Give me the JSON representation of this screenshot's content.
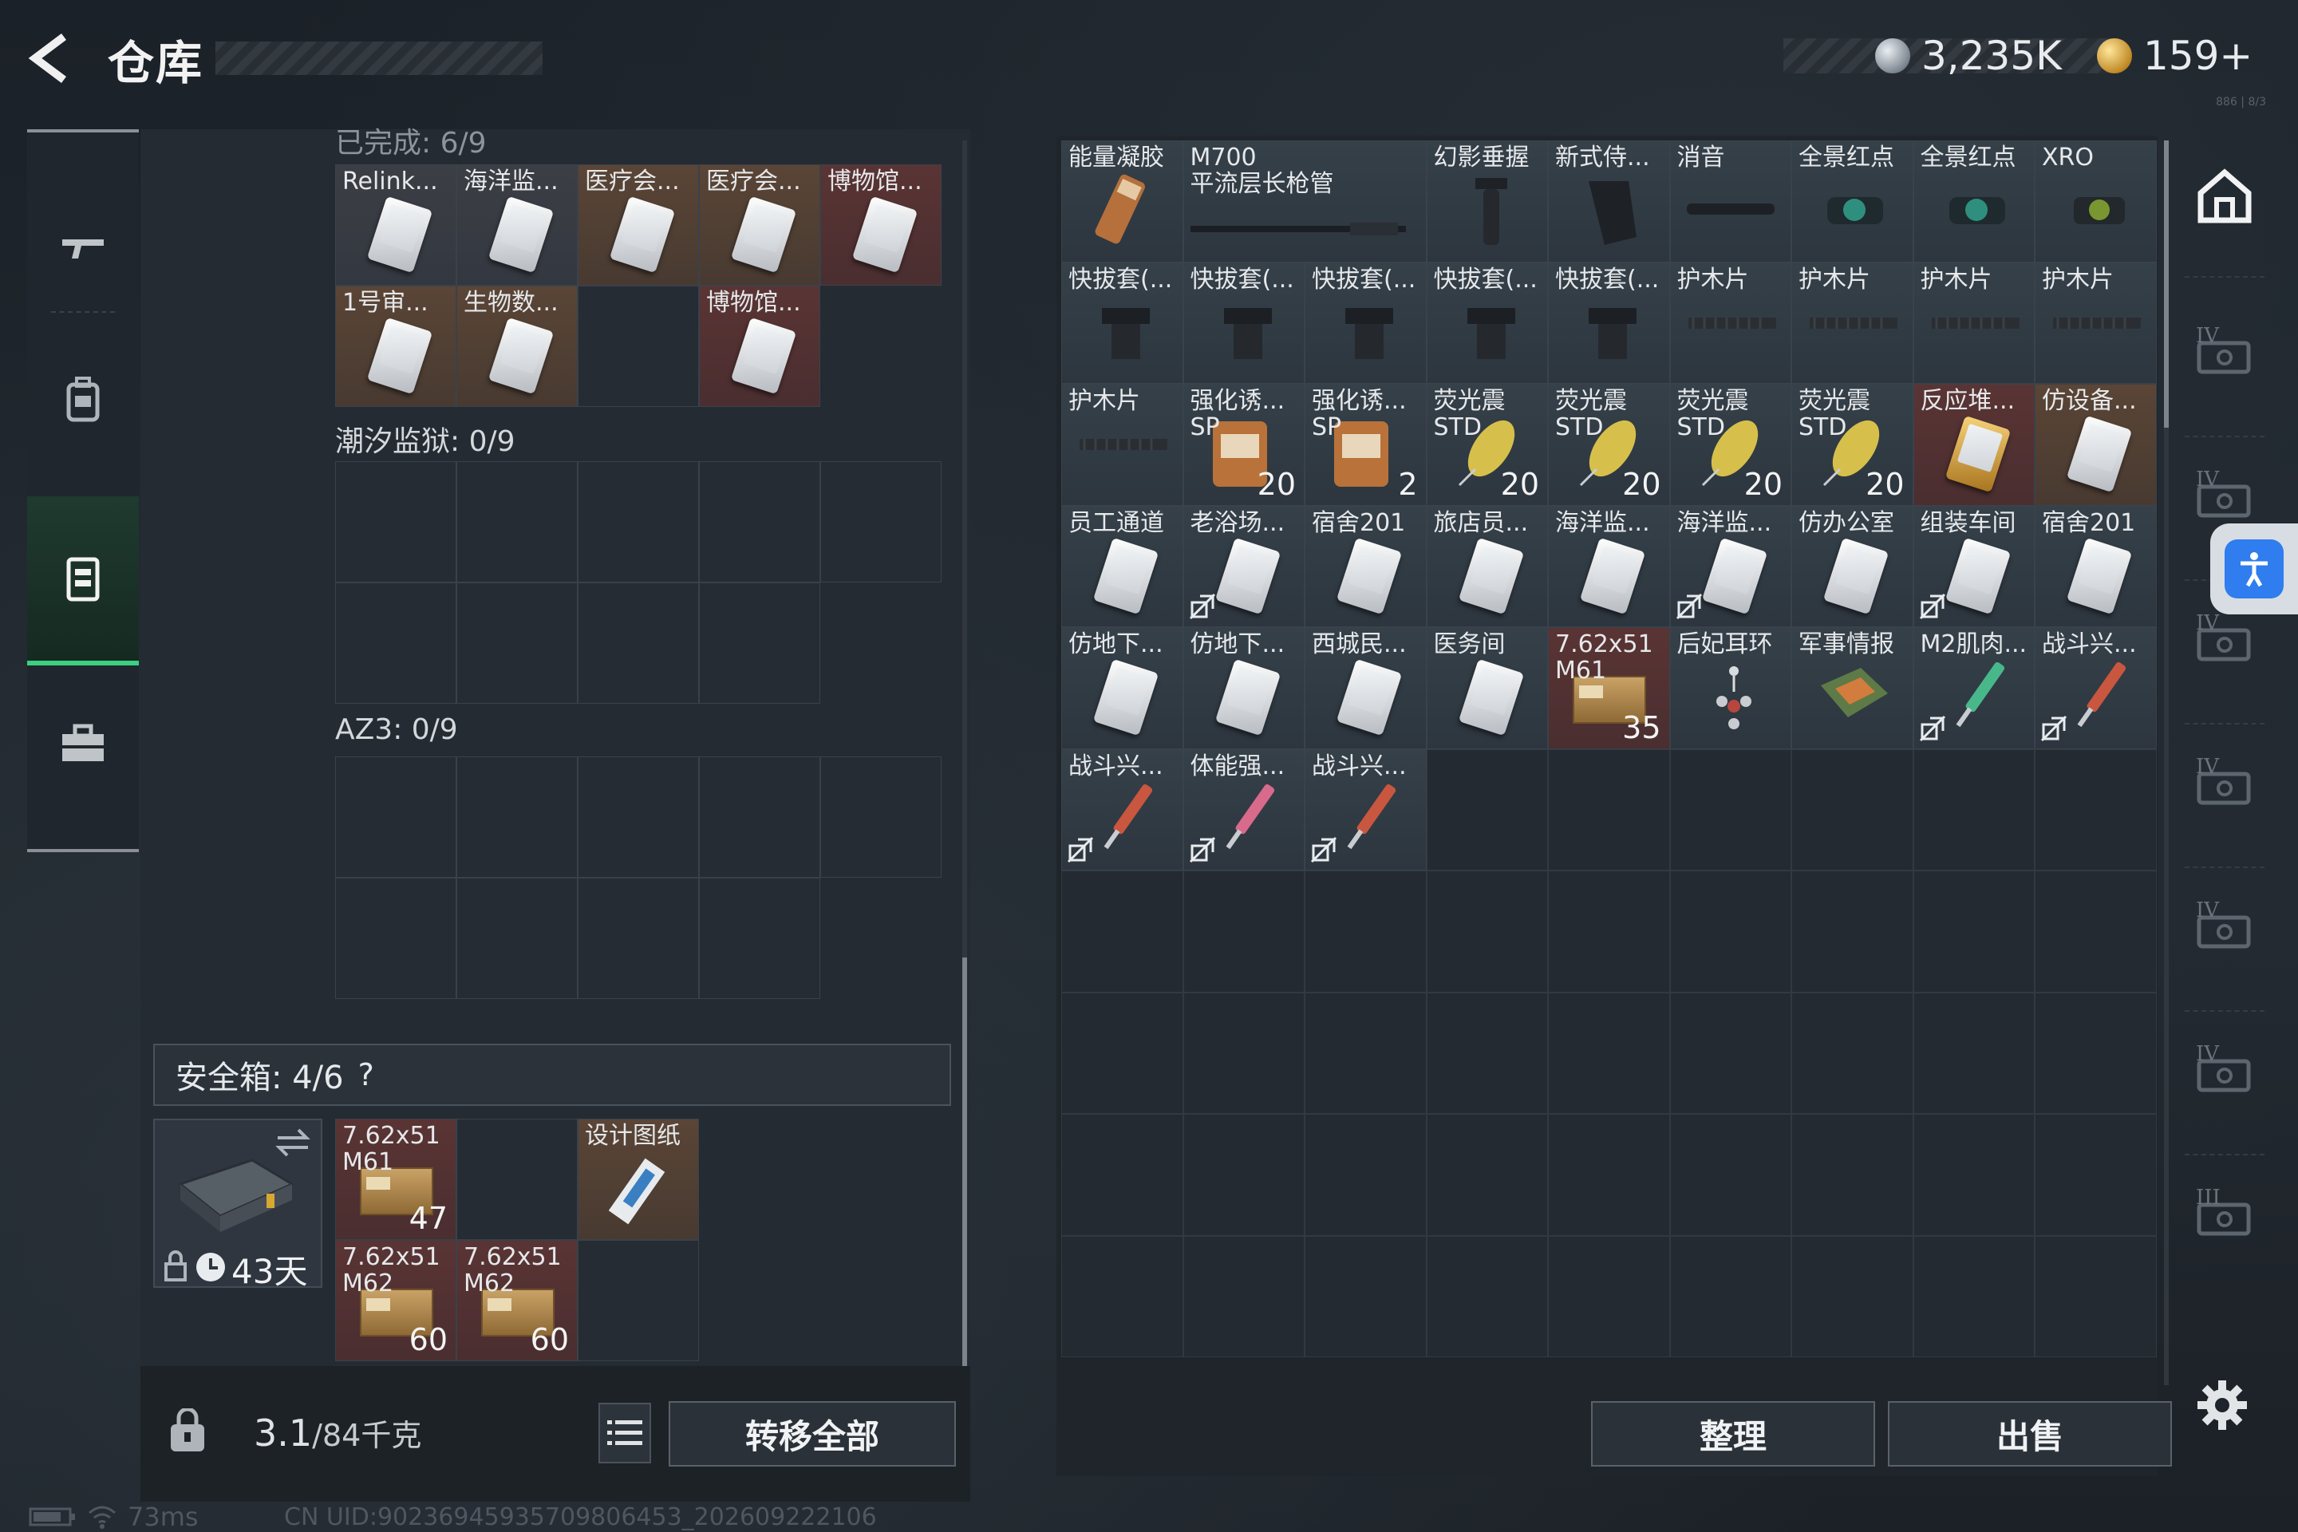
{
  "header": {
    "title": "仓库",
    "currency_silver": "3,235K",
    "currency_gold": "159+",
    "tiny_corner_text": "886 | 8/3"
  },
  "left_nav": {
    "items": [
      {
        "icon": "gun-icon"
      },
      {
        "icon": "backpack-icon"
      },
      {
        "icon": "vest-icon",
        "active": true
      },
      {
        "icon": "briefcase-icon"
      }
    ]
  },
  "inventory": {
    "top_partial_label": "已完成: 6/9",
    "collection1": [
      {
        "label": "Relink...",
        "style": "filled"
      },
      {
        "label": "海洋监...",
        "style": "filled"
      },
      {
        "label": "医疗会...",
        "style": "brown"
      },
      {
        "label": "医疗会...",
        "style": "brown"
      },
      {
        "label": "博物馆...",
        "style": "red"
      },
      {
        "label": "1号审...",
        "style": "brown"
      },
      {
        "label": "生物数...",
        "style": "brown"
      },
      {
        "label": "",
        "style": "dark"
      },
      {
        "label": "博物馆...",
        "style": "red"
      },
      {
        "label": "",
        "style": "empty"
      }
    ],
    "collection2_label": "潮汐监狱: 0/9",
    "collection3_label": "AZ3: 0/9"
  },
  "safe_box": {
    "label": "安全箱: 4/6",
    "help": "?",
    "days_left": "43天",
    "items": [
      {
        "label": "7.62x51\nM61",
        "count": "47",
        "kind": "ammo"
      },
      {
        "label": "",
        "count": "",
        "kind": "empty"
      },
      {
        "label": "设计图纸",
        "count": "",
        "kind": "blueprint"
      },
      {
        "label": "7.62x51\nM62",
        "count": "60",
        "kind": "ammo"
      },
      {
        "label": "7.62x51\nM62",
        "count": "60",
        "kind": "ammo"
      },
      {
        "label": "",
        "count": "",
        "kind": "dark"
      }
    ]
  },
  "bottom_bar": {
    "weight_value": "3.1",
    "weight_capacity": "/84千克",
    "transfer_all": "转移全部"
  },
  "stash": {
    "items": [
      {
        "label": "能量凝胶",
        "count": "",
        "style": "filled",
        "art": "gel"
      },
      {
        "label": "M700\n平流层长枪管",
        "count": "",
        "style": "filled",
        "art": "barrel",
        "wide": true
      },
      {
        "label": "幻影垂握",
        "count": "",
        "style": "filled",
        "art": "grip"
      },
      {
        "label": "新式侍...",
        "count": "",
        "style": "filled",
        "art": "grip2"
      },
      {
        "label": "消音",
        "count": "",
        "style": "filled",
        "art": "suppressor"
      },
      {
        "label": "全景红点",
        "count": "",
        "style": "filled",
        "art": "scope"
      },
      {
        "label": "全景红点",
        "count": "",
        "style": "filled",
        "art": "scope"
      },
      {
        "label": "XRO",
        "count": "",
        "style": "filled",
        "art": "scope2"
      },
      {
        "label": "快拔套(...",
        "count": "",
        "style": "filled",
        "art": "holster"
      },
      {
        "label": "快拔套(...",
        "count": "",
        "style": "filled",
        "art": "holster"
      },
      {
        "label": "快拔套(...",
        "count": "",
        "style": "filled",
        "art": "holster"
      },
      {
        "label": "快拔套(...",
        "count": "",
        "style": "filled",
        "art": "holster"
      },
      {
        "label": "快拔套(...",
        "count": "",
        "style": "filled",
        "art": "holster"
      },
      {
        "label": "护木片",
        "count": "",
        "style": "filled",
        "art": "rail"
      },
      {
        "label": "护木片",
        "count": "",
        "style": "filled",
        "art": "rail"
      },
      {
        "label": "护木片",
        "count": "",
        "style": "filled",
        "art": "rail"
      },
      {
        "label": "护木片",
        "count": "",
        "style": "filled",
        "art": "rail"
      },
      {
        "label": "护木片",
        "count": "",
        "style": "filled",
        "art": "rail"
      },
      {
        "label": "强化诱...\nSP",
        "count": "20",
        "style": "filled",
        "art": "bag"
      },
      {
        "label": "强化诱...\nSP",
        "count": "2",
        "style": "filled",
        "art": "bag"
      },
      {
        "label": "荧光震\nSTD",
        "count": "20",
        "style": "filled",
        "art": "lure"
      },
      {
        "label": "荧光震\nSTD",
        "count": "20",
        "style": "filled",
        "art": "lure"
      },
      {
        "label": "荧光震\nSTD",
        "count": "20",
        "style": "filled",
        "art": "lure"
      },
      {
        "label": "荧光震\nSTD",
        "count": "20",
        "style": "filled",
        "art": "lure"
      },
      {
        "label": "反应堆...",
        "count": "",
        "style": "red",
        "art": "goldcard"
      },
      {
        "label": "仿设备...",
        "count": "",
        "style": "brown",
        "art": "card"
      },
      {
        "label": "员工通道",
        "count": "",
        "style": "filled",
        "art": "card"
      },
      {
        "label": "老浴场...",
        "count": "",
        "style": "filled",
        "art": "card",
        "norefund": true
      },
      {
        "label": "宿舍201",
        "count": "",
        "style": "filled",
        "art": "card"
      },
      {
        "label": "旅店员...",
        "count": "",
        "style": "filled",
        "art": "card"
      },
      {
        "label": "海洋监...",
        "count": "",
        "style": "filled",
        "art": "card"
      },
      {
        "label": "海洋监...",
        "count": "",
        "style": "filled",
        "art": "card",
        "norefund": true
      },
      {
        "label": "仿办公室",
        "count": "",
        "style": "filled",
        "art": "card"
      },
      {
        "label": "组装车间",
        "count": "",
        "style": "filled",
        "art": "card",
        "norefund": true
      },
      {
        "label": "宿舍201",
        "count": "",
        "style": "filled",
        "art": "card"
      },
      {
        "label": "仿地下...",
        "count": "",
        "style": "filled",
        "art": "card"
      },
      {
        "label": "仿地下...",
        "count": "",
        "style": "filled",
        "art": "card"
      },
      {
        "label": "西城民...",
        "count": "",
        "style": "filled",
        "art": "card"
      },
      {
        "label": "医务间",
        "count": "",
        "style": "filled",
        "art": "card"
      },
      {
        "label": "7.62x51\nM61",
        "count": "35",
        "style": "red",
        "art": "ammo"
      },
      {
        "label": "后妃耳环",
        "count": "",
        "style": "filled",
        "art": "earring"
      },
      {
        "label": "军事情报",
        "count": "",
        "style": "filled",
        "art": "chip"
      },
      {
        "label": "M2肌肉...",
        "count": "",
        "style": "filled",
        "art": "syringe-green",
        "norefund": true
      },
      {
        "label": "战斗兴...",
        "count": "",
        "style": "filled",
        "art": "syringe-red",
        "norefund": true
      },
      {
        "label": "战斗兴...",
        "count": "",
        "style": "filled",
        "art": "syringe-red",
        "norefund": true
      },
      {
        "label": "体能强...",
        "count": "",
        "style": "filled",
        "art": "syringe-pink",
        "norefund": true
      },
      {
        "label": "战斗兴...",
        "count": "",
        "style": "filled",
        "art": "syringe-red",
        "norefund": true
      }
    ],
    "sort_button": "整理",
    "sell_button": "出售"
  },
  "right_nav": {
    "tiers": [
      "",
      "IV",
      "IV",
      "IV",
      "IV",
      "IV",
      "IV",
      "III"
    ]
  },
  "status_bar": {
    "ping": "73ms",
    "uid": "CN UID:90236945935709806453_202609222106"
  },
  "colors": {
    "accent_green": "#3bcf82",
    "accessibility_blue": "#2f7dee"
  }
}
